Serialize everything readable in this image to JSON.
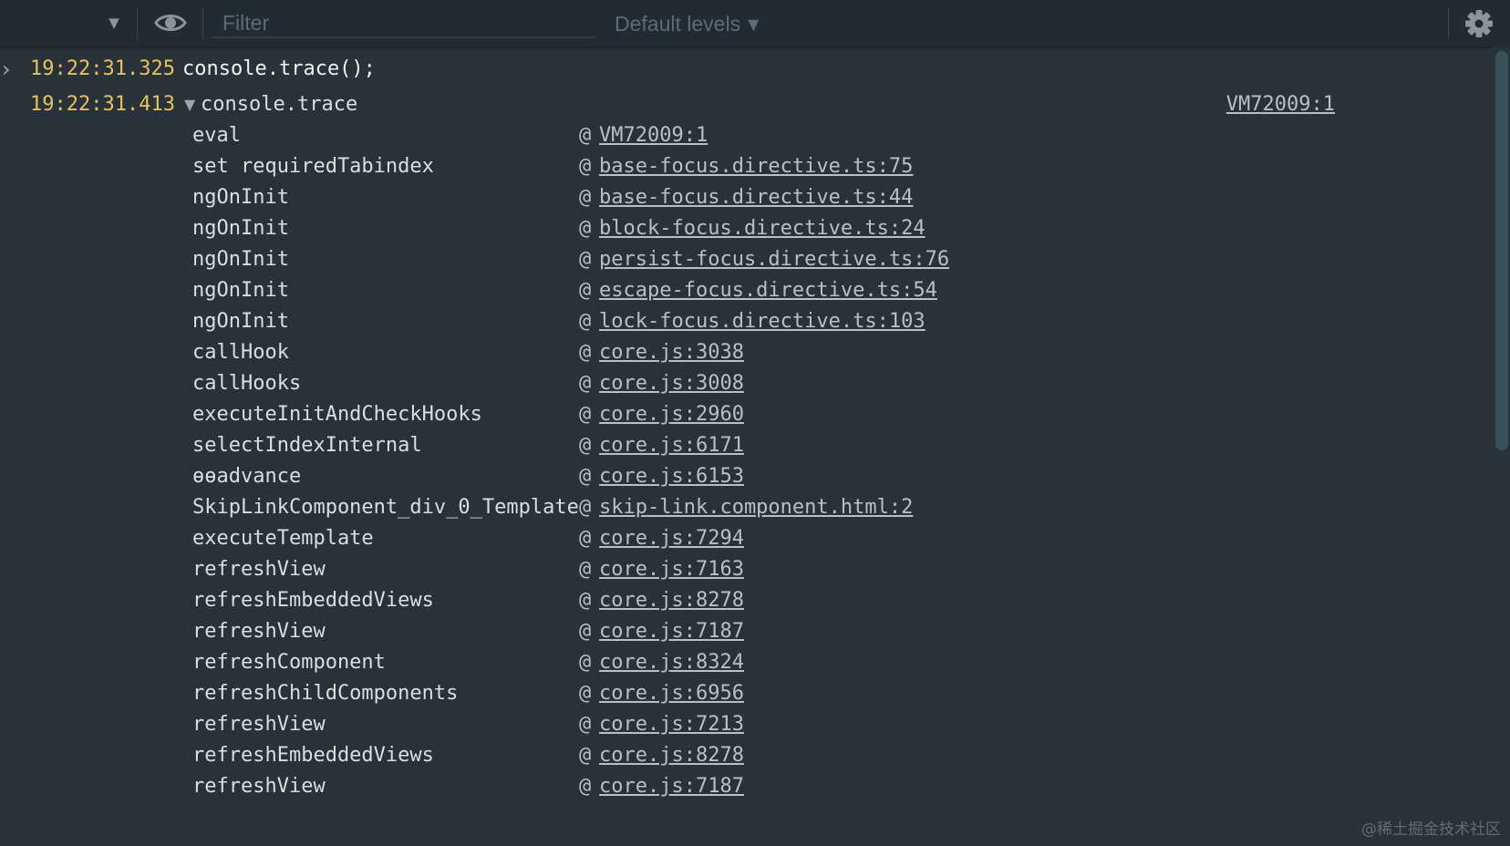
{
  "toolbar": {
    "chevron_icon": "chevron-down-icon",
    "eye_icon": "eye-icon",
    "filter_placeholder": "Filter",
    "filter_value": "",
    "levels_label": "Default levels",
    "levels_caret": "▼",
    "chevron_glyph": "▼",
    "gear_icon": "gear-icon"
  },
  "console": {
    "input": {
      "prompt_glyph": "›",
      "timestamp": "19:22:31.325",
      "command": "console.trace();"
    },
    "trace": {
      "timestamp": "19:22:31.413",
      "toggle_glyph": "▼",
      "label": "console.trace",
      "source": "VM72009:1",
      "frames": [
        {
          "fn": "eval",
          "at": "@",
          "loc": "VM72009:1"
        },
        {
          "fn": "set requiredTabindex",
          "at": "@",
          "loc": "base-focus.directive.ts:75"
        },
        {
          "fn": "ngOnInit",
          "at": "@",
          "loc": "base-focus.directive.ts:44"
        },
        {
          "fn": "ngOnInit",
          "at": "@",
          "loc": "block-focus.directive.ts:24"
        },
        {
          "fn": "ngOnInit",
          "at": "@",
          "loc": "persist-focus.directive.ts:76"
        },
        {
          "fn": "ngOnInit",
          "at": "@",
          "loc": "escape-focus.directive.ts:54"
        },
        {
          "fn": "ngOnInit",
          "at": "@",
          "loc": "lock-focus.directive.ts:103"
        },
        {
          "fn": "callHook",
          "at": "@",
          "loc": "core.js:3038"
        },
        {
          "fn": "callHooks",
          "at": "@",
          "loc": "core.js:3008"
        },
        {
          "fn": "executeInitAndCheckHooks",
          "at": "@",
          "loc": "core.js:2960"
        },
        {
          "fn": "selectIndexInternal",
          "at": "@",
          "loc": "core.js:6171"
        },
        {
          "fn": "ɵɵadvance",
          "at": "@",
          "loc": "core.js:6153"
        },
        {
          "fn": "SkipLinkComponent_div_0_Template",
          "at": "@",
          "loc": "skip-link.component.html:2"
        },
        {
          "fn": "executeTemplate",
          "at": "@",
          "loc": "core.js:7294"
        },
        {
          "fn": "refreshView",
          "at": "@",
          "loc": "core.js:7163"
        },
        {
          "fn": "refreshEmbeddedViews",
          "at": "@",
          "loc": "core.js:8278"
        },
        {
          "fn": "refreshView",
          "at": "@",
          "loc": "core.js:7187"
        },
        {
          "fn": "refreshComponent",
          "at": "@",
          "loc": "core.js:8324"
        },
        {
          "fn": "refreshChildComponents",
          "at": "@",
          "loc": "core.js:6956"
        },
        {
          "fn": "refreshView",
          "at": "@",
          "loc": "core.js:7213"
        },
        {
          "fn": "refreshEmbeddedViews",
          "at": "@",
          "loc": "core.js:8278"
        },
        {
          "fn": "refreshView",
          "at": "@",
          "loc": "core.js:7187"
        }
      ]
    }
  },
  "watermark": "@稀土掘金技术社区",
  "colors": {
    "background": "#28323a",
    "toolbar": "#212b33",
    "timestamp": "#e8c15a",
    "link": "#b7c0c7",
    "scroll_thumb": "#37505a"
  }
}
